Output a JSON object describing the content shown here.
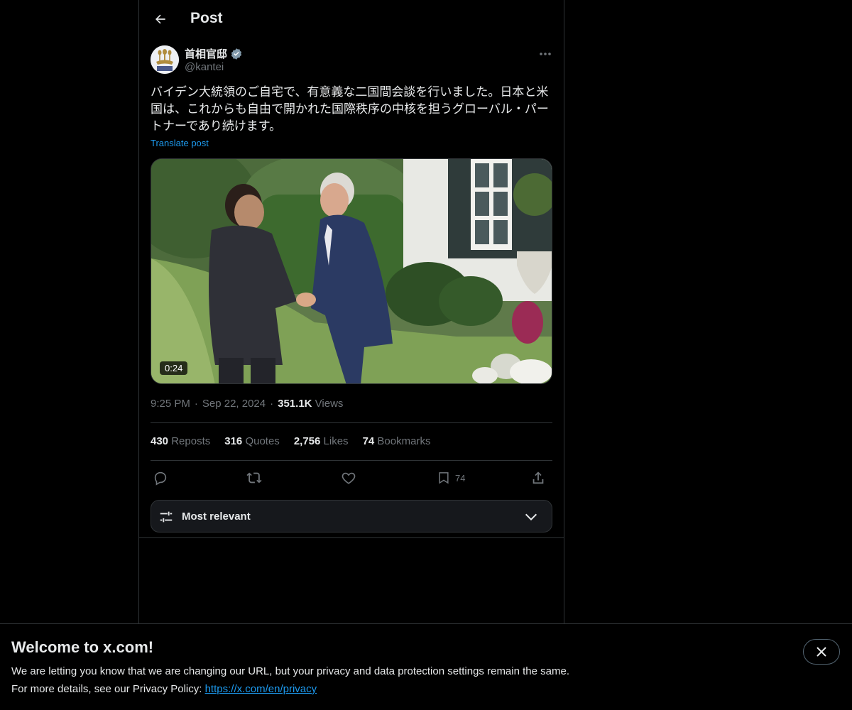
{
  "header": {
    "title": "Post"
  },
  "author": {
    "name": "首相官邸",
    "handle": "@kantei",
    "verified": true
  },
  "post": {
    "text": "バイデン大統領のご自宅で、有意義な二国間会談を行いました。日本と米国は、これからも自由で開かれた国際秩序の中核を担うグローバル・パートナーであり続けます。",
    "translate_label": "Translate post",
    "video_duration": "0:24",
    "time": "9:25 PM",
    "date": "Sep 22, 2024",
    "views_count": "351.1K",
    "views_label": "Views"
  },
  "stats": {
    "reposts_count": "430",
    "reposts_label": "Reposts",
    "quotes_count": "316",
    "quotes_label": "Quotes",
    "likes_count": "2,756",
    "likes_label": "Likes",
    "bookmarks_count": "74",
    "bookmarks_label": "Bookmarks"
  },
  "actions": {
    "bookmark_count": "74"
  },
  "sort": {
    "label": "Most relevant"
  },
  "banner": {
    "title": "Welcome to x.com!",
    "line1": "We are letting you know that we are changing our URL, but your privacy and data protection settings remain the same.",
    "line2_prefix": "For more details, see our Privacy Policy: ",
    "link": "https://x.com/en/privacy"
  },
  "colors": {
    "accent": "#1d9bf0",
    "background": "#000000",
    "border": "#2f3336",
    "muted": "#71767b"
  }
}
